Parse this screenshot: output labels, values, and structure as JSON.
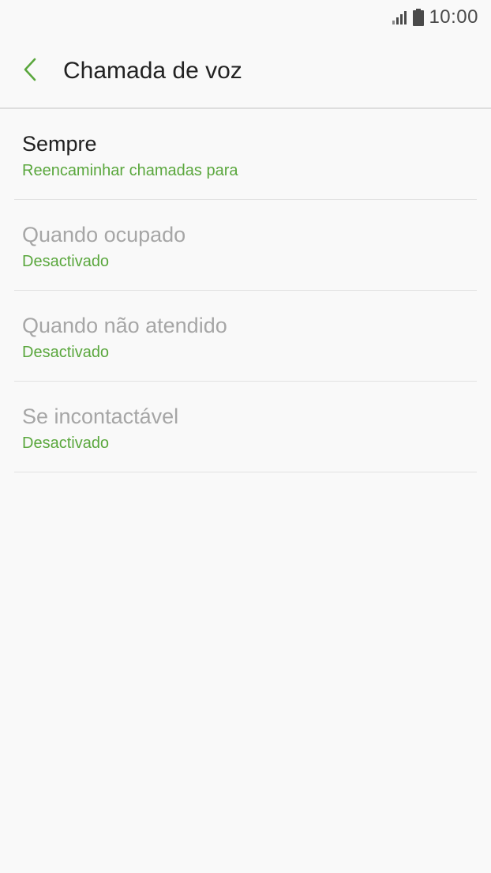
{
  "status_bar": {
    "time": "10:00",
    "icons": [
      "signal-icon",
      "battery-icon"
    ]
  },
  "header": {
    "title": "Chamada de voz",
    "back_icon": "chevron-left-icon"
  },
  "colors": {
    "accent": "#5aa73d",
    "title_enabled": "#1f1f1f",
    "title_disabled": "#a6a6a6",
    "background": "#f9f9f9",
    "divider": "#e3e3e3"
  },
  "items": [
    {
      "title": "Sempre",
      "subtitle": "Reencaminhar chamadas para",
      "enabled": true
    },
    {
      "title": "Quando ocupado",
      "subtitle": "Desactivado",
      "enabled": false
    },
    {
      "title": "Quando não atendido",
      "subtitle": "Desactivado",
      "enabled": false
    },
    {
      "title": "Se incontactável",
      "subtitle": "Desactivado",
      "enabled": false
    }
  ]
}
